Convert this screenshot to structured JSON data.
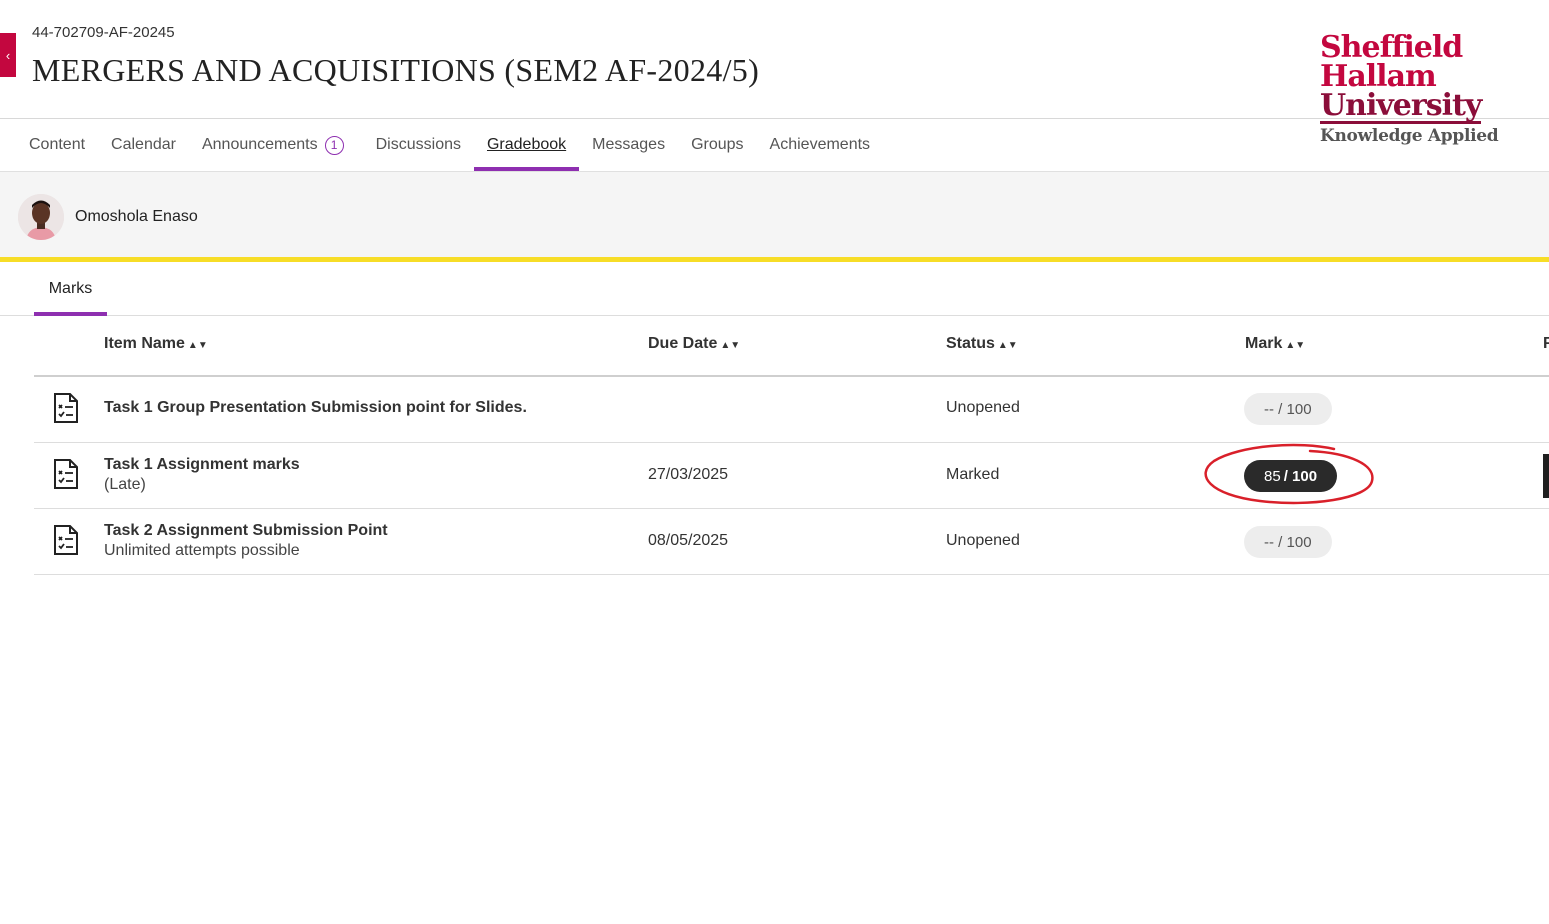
{
  "course": {
    "id": "44-702709-AF-20245",
    "title": "MERGERS AND ACQUISITIONS (SEM2 AF-2024/5)"
  },
  "logo": {
    "line1": "Sheffield",
    "line2": "Hallam",
    "line3": "University",
    "tagline": "Knowledge Applied"
  },
  "nav": {
    "tabs": [
      {
        "label": "Content"
      },
      {
        "label": "Calendar"
      },
      {
        "label": "Announcements",
        "badge": "1"
      },
      {
        "label": "Discussions"
      },
      {
        "label": "Gradebook",
        "active": true
      },
      {
        "label": "Messages"
      },
      {
        "label": "Groups"
      },
      {
        "label": "Achievements"
      }
    ]
  },
  "user": {
    "name": "Omoshola Enaso"
  },
  "subtabs": {
    "marks": "Marks"
  },
  "table": {
    "headers": {
      "item_name": "Item Name",
      "due_date": "Due Date",
      "status": "Status",
      "mark": "Mark",
      "trailing": "F"
    },
    "rows": [
      {
        "title": "Task 1 Group Presentation Submission point for Slides.",
        "subtitle": "",
        "due": "",
        "status": "Unopened",
        "score": "--",
        "out_of": "/ 100"
      },
      {
        "title": "Task 1 Assignment marks",
        "subtitle": "(Late)",
        "due": "27/03/2025",
        "status": "Marked",
        "score": "85",
        "out_of": "/ 100"
      },
      {
        "title": "Task 2 Assignment Submission Point",
        "subtitle": "Unlimited attempts possible",
        "due": "08/05/2025",
        "status": "Unopened",
        "score": "--",
        "out_of": "/ 100"
      }
    ]
  },
  "colors": {
    "brand": "#c3073f",
    "accent": "#8e2fb0",
    "highlight": "#f7dd27",
    "annotation": "#d9202a"
  }
}
